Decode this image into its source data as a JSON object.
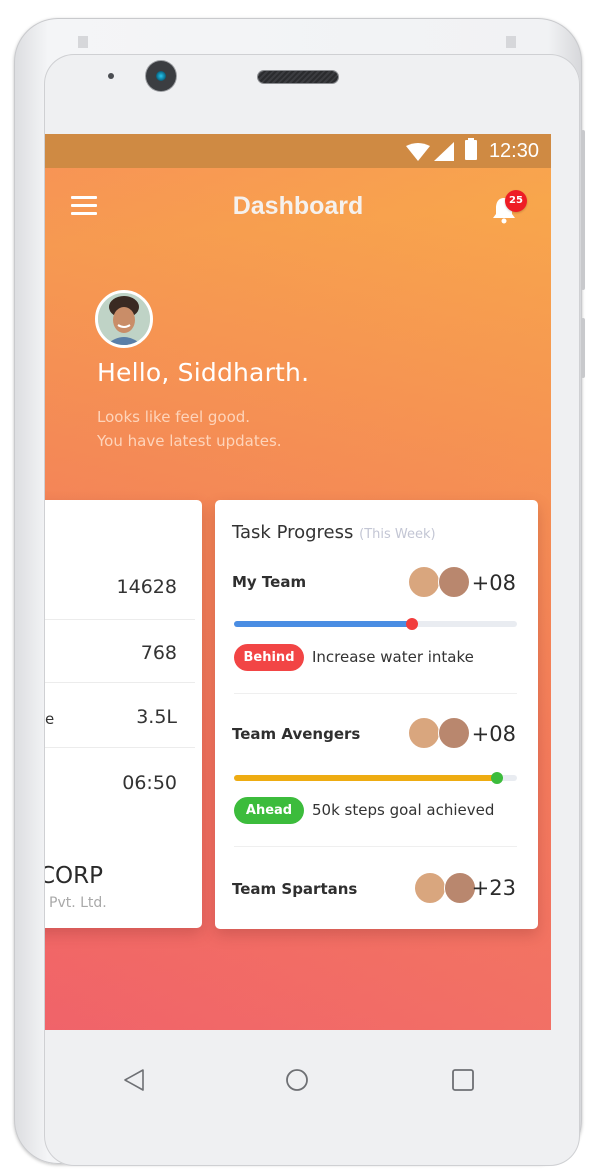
{
  "status_bar": {
    "time": "12:30",
    "icons": [
      "wifi-icon",
      "signal-icon",
      "battery-icon"
    ]
  },
  "app_bar": {
    "title": "Dashboard",
    "menu_icon": "hamburger-menu-icon",
    "notification_icon": "bell-icon",
    "notification_count": "25"
  },
  "hero": {
    "greeting": "Hello, Siddharth.",
    "subtitle_line1": "Looks like feel good.",
    "subtitle_line2": "You have latest updates."
  },
  "left_card": {
    "rows": [
      {
        "label": "",
        "value": "14628"
      },
      {
        "label": "",
        "value": "768"
      },
      {
        "label": "e",
        "value": "3.5L"
      },
      {
        "label": "",
        "value": "06:50"
      }
    ],
    "company_name": "CORP",
    "company_suffix": "Pvt. Ltd."
  },
  "task_progress": {
    "title": "Task Progress",
    "period": "(This Week)",
    "teams": [
      {
        "name": "My Team",
        "extra_members": "+08",
        "progress": 0.63,
        "bar_color": "#4a8de3",
        "knob_color": "#f23d3d",
        "status": "Behind",
        "status_color": "#f24545",
        "message": "Increase water intake"
      },
      {
        "name": "Team Avengers",
        "extra_members": "+08",
        "progress": 0.93,
        "bar_color": "#eeac12",
        "knob_color": "#3cbc3c",
        "status": "Ahead",
        "status_color": "#3cbc3c",
        "message": "50k steps goal achieved"
      },
      {
        "name": "Team Spartans",
        "extra_members": "+23"
      }
    ]
  },
  "nav_bar": {
    "buttons": [
      "back-icon",
      "home-icon",
      "recent-apps-icon"
    ]
  },
  "colors": {
    "status_bar": "#cf8a43",
    "gradient_top": "#f99a54",
    "gradient_bottom": "#f0626b",
    "badge": "#ee1c25"
  }
}
